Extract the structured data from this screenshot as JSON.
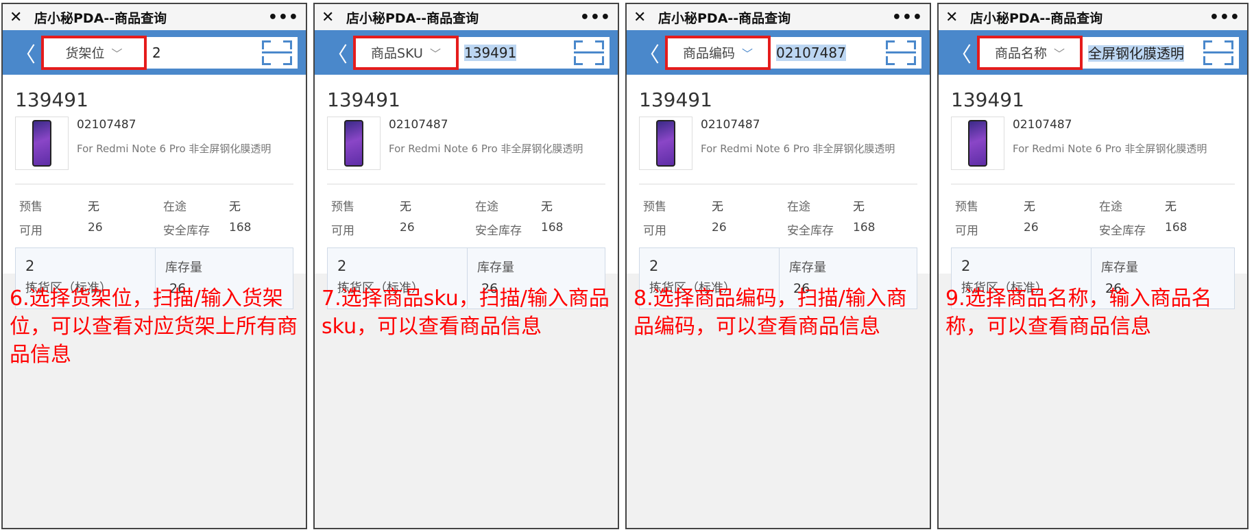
{
  "window": {
    "title": "店小秘PDA--商品查询",
    "close_icon": "close-icon",
    "more_icon": "more-icon"
  },
  "product": {
    "sku": "139491",
    "code": "02107487",
    "name": "For Redmi Note 6 Pro 非全屏钢化膜透明"
  },
  "stats": {
    "presale_label": "预售",
    "presale_value": "无",
    "transit_label": "在途",
    "transit_value": "无",
    "available_label": "可用",
    "available_value": "26",
    "safety_label": "安全库存",
    "safety_value": "168"
  },
  "shelf": {
    "number": "2",
    "area": "拣货区（标准）",
    "qty_label": "库存量",
    "qty_value": "26"
  },
  "panels": [
    {
      "select_label": "货架位",
      "search_value": "2",
      "caption": "6.选择货架位，扫描/输入货架位，可以查看对应货架上所有商品信息"
    },
    {
      "select_label": "商品SKU",
      "search_value": "139491",
      "caption": "7.选择商品sku，扫描/输入商品sku，可以查看商品信息"
    },
    {
      "select_label": "商品编码",
      "search_value": "02107487",
      "caption": "8.选择商品编码，扫描/输入商品编码，可以查看商品信息"
    },
    {
      "select_label": "商品名称",
      "search_value": "全屏钢化膜透明",
      "caption": "9.选择商品名称，输入商品名称，可以查看商品信息"
    }
  ],
  "colors": {
    "accent": "#4a88cb",
    "highlight": "#e51c1c",
    "caption": "#ff0000"
  }
}
